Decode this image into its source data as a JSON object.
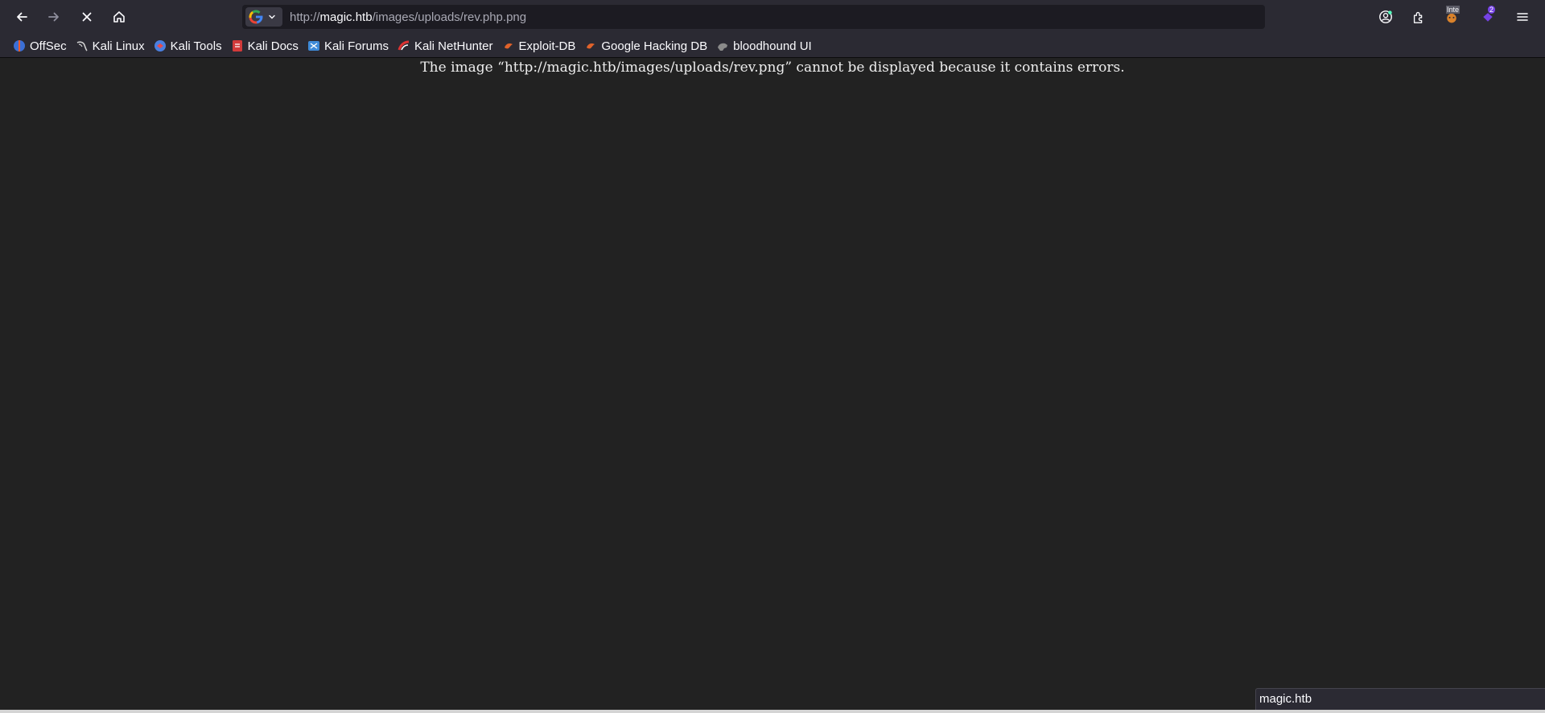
{
  "toolbar": {
    "back_icon": "arrow-left-icon",
    "forward_icon": "arrow-right-icon",
    "stop_icon": "close-icon",
    "home_icon": "home-icon"
  },
  "urlbar": {
    "search_engine": "google-icon",
    "url_scheme": "http://",
    "url_host": "magic.htb",
    "url_path": "/images/uploads/rev.php.png"
  },
  "right_toolbar": {
    "account_icon": "account-icon",
    "extensions_icon": "puzzle-icon",
    "ext1_badge": "Inte",
    "ext2_badge": "2",
    "menu_icon": "hamburger-menu-icon"
  },
  "bookmarks": [
    {
      "label": "OffSec",
      "icon": "offsec-icon",
      "color": "#3b6fd6"
    },
    {
      "label": "Kali Linux",
      "icon": "kali-dragon-icon",
      "color": "#cfcfcf"
    },
    {
      "label": "Kali Tools",
      "icon": "kali-tools-icon",
      "color": "#4a7fe0"
    },
    {
      "label": "Kali Docs",
      "icon": "kali-docs-icon",
      "color": "#d23a3a"
    },
    {
      "label": "Kali Forums",
      "icon": "kali-forums-icon",
      "color": "#3e8ad8"
    },
    {
      "label": "Kali NetHunter",
      "icon": "nethunter-icon",
      "color": "#d33"
    },
    {
      "label": "Exploit-DB",
      "icon": "exploit-db-icon",
      "color": "#e0622a"
    },
    {
      "label": "Google Hacking DB",
      "icon": "ghdb-icon",
      "color": "#e0622a"
    },
    {
      "label": "bloodhound UI",
      "icon": "bloodhound-icon",
      "color": "#8a8a8a"
    }
  ],
  "content": {
    "error_message": "The image “http://magic.htb/images/uploads/rev.png” cannot be displayed because it contains errors."
  },
  "status_bar": {
    "text": "magic.htb"
  }
}
